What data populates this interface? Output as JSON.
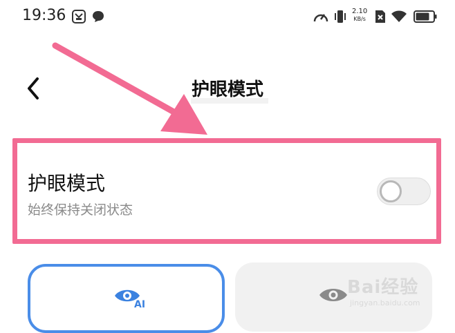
{
  "status_bar": {
    "time": "19:36",
    "net_speed_value": "2.10",
    "net_speed_unit": "KB/s",
    "icons": [
      "app-notification-icon",
      "chat-bubble-icon",
      "speedometer-icon",
      "vibrate-icon",
      "sim-none-icon",
      "wifi-icon",
      "battery-icon"
    ]
  },
  "header": {
    "back_icon": "chevron-left-icon",
    "title": "护眼模式"
  },
  "setting": {
    "title": "护眼模式",
    "subtitle": "始终保持关闭状态",
    "toggle_on": false
  },
  "mode_cards": [
    {
      "icon": "eye-ai-icon",
      "selected": true,
      "accent": "#4a8de8"
    },
    {
      "icon": "eye-icon",
      "selected": false
    }
  ],
  "annotation": {
    "highlight_color": "#f26b93",
    "arrow_color": "#f26b93"
  },
  "watermark": {
    "line1": "Bai经验",
    "line2": "jingyan.baidu.com"
  }
}
